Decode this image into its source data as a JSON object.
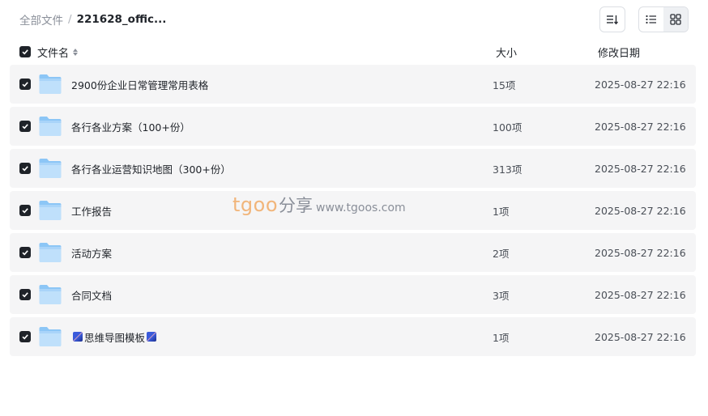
{
  "breadcrumb": {
    "root": "全部文件",
    "separator": "/",
    "current": "221628_offic..."
  },
  "toolbar": {
    "sort_icon": "sort-lines-icon",
    "list_view_icon": "list-view-icon",
    "grid_view_icon": "grid-view-icon",
    "active_view": "grid"
  },
  "table": {
    "headers": {
      "name": "文件名",
      "size": "大小",
      "modified": "修改日期"
    },
    "rows": [
      {
        "name_prefix": "",
        "name": "2900份企业日常管理常用表格",
        "name_suffix": "",
        "size": "15项",
        "modified": "2025-08-27 22:16",
        "checked": true
      },
      {
        "name_prefix": "",
        "name": "各行各业方案（100+份）",
        "name_suffix": "",
        "size": "100项",
        "modified": "2025-08-27 22:16",
        "checked": true
      },
      {
        "name_prefix": "",
        "name": "各行各业运营知识地图（300+份）",
        "name_suffix": "",
        "size": "313项",
        "modified": "2025-08-27 22:16",
        "checked": true
      },
      {
        "name_prefix": "",
        "name": "工作报告",
        "name_suffix": "",
        "size": "1项",
        "modified": "2025-08-27 22:16",
        "checked": true
      },
      {
        "name_prefix": "",
        "name": "活动方案",
        "name_suffix": "",
        "size": "2项",
        "modified": "2025-08-27 22:16",
        "checked": true
      },
      {
        "name_prefix": "",
        "name": "合同文档",
        "name_suffix": "",
        "size": "3项",
        "modified": "2025-08-27 22:16",
        "checked": true
      },
      {
        "name_prefix": "emoji",
        "name": "思维导图模板",
        "name_suffix": "emoji",
        "size": "1项",
        "modified": "2025-08-27 22:16",
        "checked": true
      }
    ]
  },
  "watermark": {
    "brand": "tgoo",
    "share": "分享",
    "url": "www.tgoos.com"
  },
  "colors": {
    "row_bg": "#f5f5f6",
    "checkbox": "#1f2329",
    "folder_light": "#bfe0fb",
    "folder_dark": "#8cc6f6",
    "watermark_brand": "#f1b57a"
  }
}
